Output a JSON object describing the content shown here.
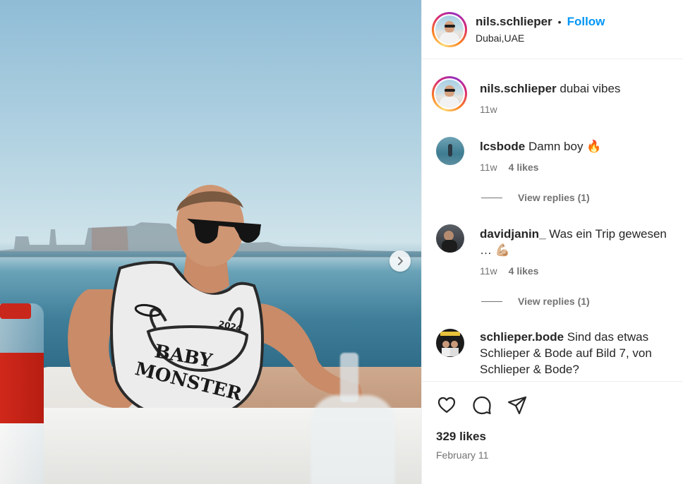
{
  "post": {
    "author": "nils.schlieper",
    "separator": "•",
    "follow_label": "Follow",
    "location": "Dubai,UAE"
  },
  "caption": {
    "user": "nils.schlieper",
    "text": "dubai vibes",
    "age": "11w"
  },
  "comments": [
    {
      "user": "lcsbode",
      "text": "Damn boy 🔥",
      "age": "11w",
      "likes": "4 likes",
      "replies": "View replies (1)"
    },
    {
      "user": "davidjanin_",
      "text": "Was ein Trip gewesen … 💪🏼",
      "age": "11w",
      "likes": "4 likes",
      "replies": "View replies (1)"
    },
    {
      "user": "schlieper.bode",
      "text": "Sind das etwas Schlieper & Bode auf Bild 7, von Schlieper & Bode?"
    }
  ],
  "actions": {
    "like_icon": "heart-icon",
    "comment_icon": "comment-icon",
    "share_icon": "share-icon",
    "likes_total": "329 likes",
    "date": "February 11"
  },
  "photo": {
    "shirt_text_1": "BABY",
    "shirt_text_2": "MONSTER",
    "shirt_number": "2024"
  }
}
